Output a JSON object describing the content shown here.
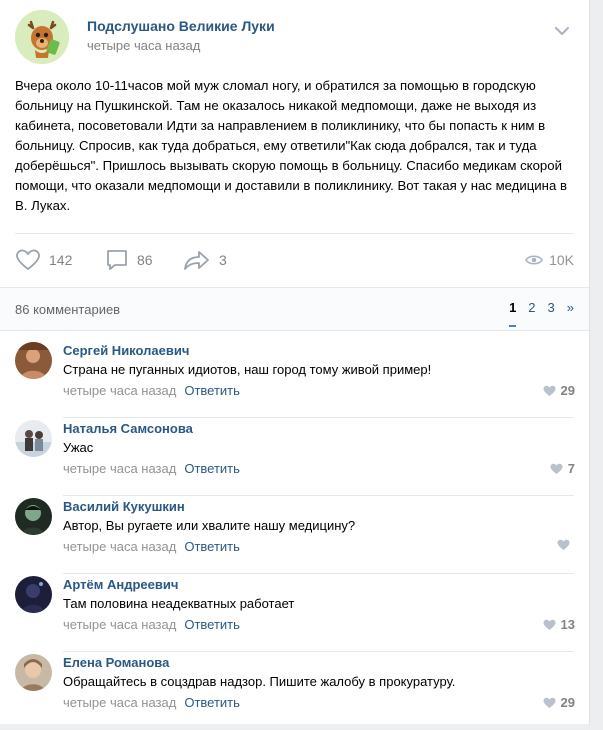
{
  "post": {
    "community_name": "Подслушано Великие Луки",
    "time": "четыре часа назад",
    "text": "Вчера около 10-11часов мой муж сломал ногу, и обратился за помощью в городскую больницу на Пушкинской. Там не оказалось никакой медпомощи, даже не выходя из кабинета, посоветовали Идти за направлением в поликлинику, что бы попасть к ним в больницу. Спросив, как туда добраться, ему ответили\"Как сюда добрался, так и туда доберёшься\". Пришлось вызывать скорую помощь в больницу. Спасибо медикам скорой помощи, что оказали медпомощи и доставили в поликлинику. Вот такая у нас медицина в В. Луках.",
    "likes": "142",
    "comments": "86",
    "shares": "3",
    "views": "10K"
  },
  "comments_section": {
    "count_label": "86 комментариев",
    "pages": [
      "1",
      "2",
      "3",
      "»"
    ]
  },
  "comments": [
    {
      "author": "Сергей Николаевич",
      "text": "Страна не пуганных идиотов, наш город тому живой пример!",
      "time": "четыре часа назад",
      "reply": "Ответить",
      "likes": "29"
    },
    {
      "author": "Наталья Самсонова",
      "text": "Ужас",
      "time": "четыре часа назад",
      "reply": "Ответить",
      "likes": "7"
    },
    {
      "author": "Василий Кукушкин",
      "text": "Автор, Вы ругаете или хвалите нашу медицину?",
      "time": "четыре часа назад",
      "reply": "Ответить",
      "likes": ""
    },
    {
      "author": "Артём Андреевич",
      "text": "Там половина неадекватных работает",
      "time": "четыре часа назад",
      "reply": "Ответить",
      "likes": "13"
    },
    {
      "author": "Елена Романова",
      "text": "Обращайтесь в соцздрав надзор. Пишите жалобу в прокуратуру.",
      "time": "четыре часа назад",
      "reply": "Ответить",
      "likes": "29"
    }
  ],
  "colors": {
    "link": "#2a5885",
    "muted": "#828282",
    "accent": "#5181b8"
  }
}
